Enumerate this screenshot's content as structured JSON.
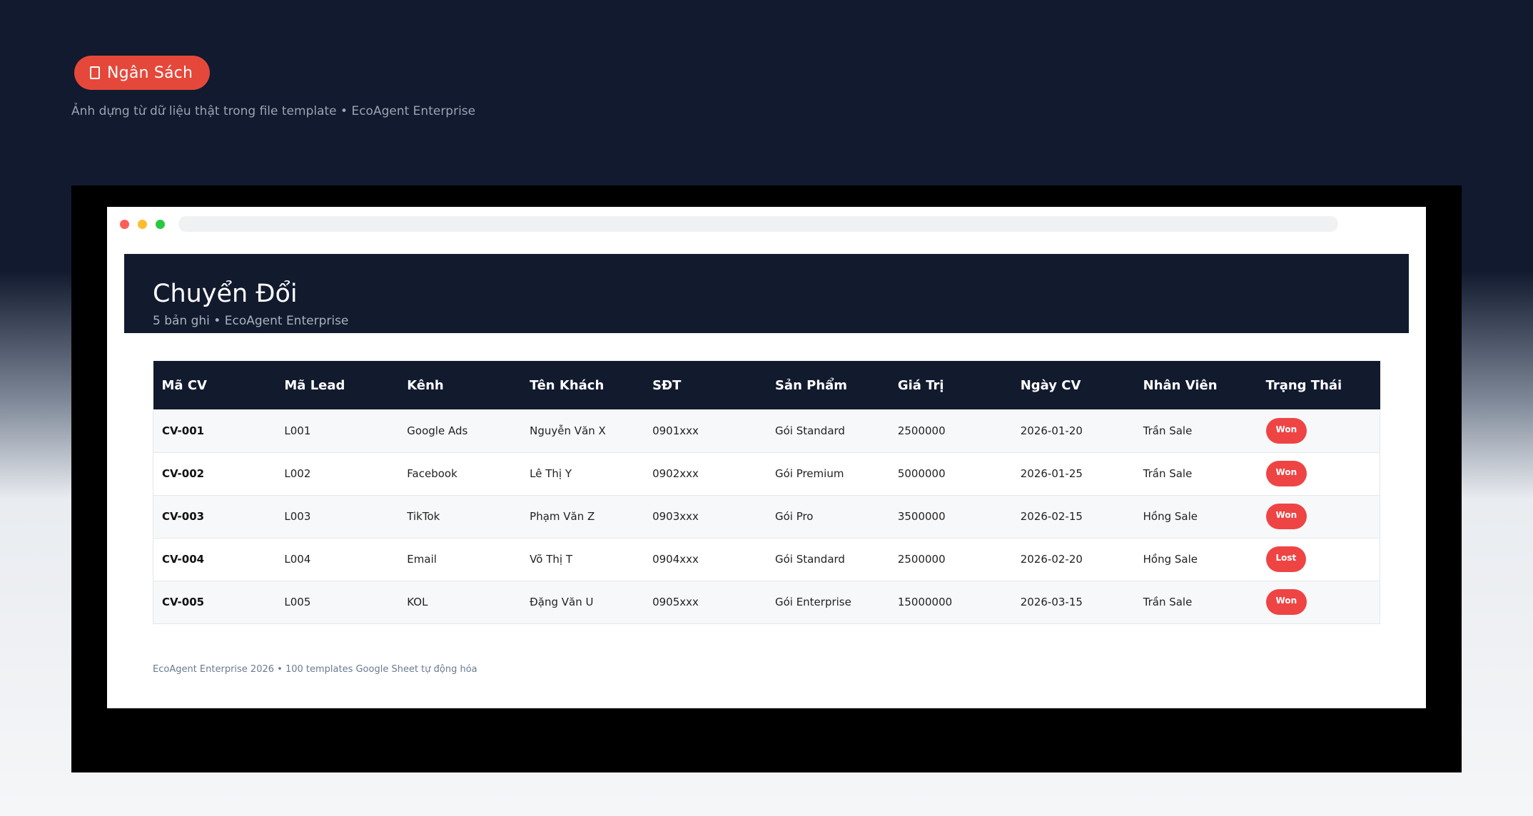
{
  "badge": {
    "label": "Ngân Sách"
  },
  "subtitle": "Ảnh dựng từ dữ liệu thật trong file template • EcoAgent Enterprise",
  "sheet": {
    "title": "Chuyển Đổi",
    "subtitle": "5 bản ghi • EcoAgent Enterprise",
    "columns": [
      "Mã CV",
      "Mã Lead",
      "Kênh",
      "Tên Khách",
      "SĐT",
      "Sản Phẩm",
      "Giá Trị",
      "Ngày CV",
      "Nhân Viên",
      "Trạng Thái"
    ],
    "rows": [
      [
        "CV-001",
        "L001",
        "Google Ads",
        "Nguyễn Văn X",
        "0901xxx",
        "Gói Standard",
        "2500000",
        "2026-01-20",
        "Trần Sale",
        "Won"
      ],
      [
        "CV-002",
        "L002",
        "Facebook",
        "Lê Thị Y",
        "0902xxx",
        "Gói Premium",
        "5000000",
        "2026-01-25",
        "Trần Sale",
        "Won"
      ],
      [
        "CV-003",
        "L003",
        "TikTok",
        "Phạm Văn Z",
        "0903xxx",
        "Gói Pro",
        "3500000",
        "2026-02-15",
        "Hồng Sale",
        "Won"
      ],
      [
        "CV-004",
        "L004",
        "Email",
        "Võ Thị T",
        "0904xxx",
        "Gói Standard",
        "2500000",
        "2026-02-20",
        "Hồng Sale",
        "Lost"
      ],
      [
        "CV-005",
        "L005",
        "KOL",
        "Đặng Văn U",
        "0905xxx",
        "Gói Enterprise",
        "15000000",
        "2026-03-15",
        "Trần Sale",
        "Won"
      ]
    ],
    "footer": "EcoAgent Enterprise 2026 • 100 templates Google Sheet tự động hóa"
  },
  "colors": {
    "accent": "#e5483a",
    "header_bg": "#121a2e",
    "status_bg": "#ef4444",
    "dot_red": "#ff5f57",
    "dot_yellow": "#febc2e",
    "dot_green": "#28c840"
  }
}
